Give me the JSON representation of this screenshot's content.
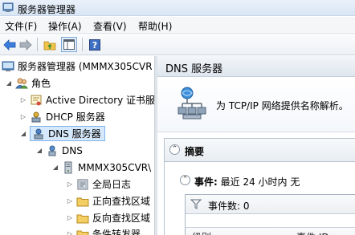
{
  "window": {
    "title": "服务器管理器"
  },
  "menu": [
    "文件(F)",
    "操作(A)",
    "查看(V)",
    "帮助(H)"
  ],
  "toolbar": {
    "icons": [
      "back-arrow-icon",
      "forward-arrow-icon",
      "up-folder-icon",
      "show-hide-tree-icon",
      "help-icon"
    ]
  },
  "tree": {
    "root": "服务器管理器 (MMMX305CVR",
    "roles": "角色",
    "adcs": "Active Directory 证书服",
    "dhcp": "DHCP 服务器",
    "dns_server": "DNS 服务器",
    "dns": "DNS",
    "host": "MMMX305CVR\\",
    "global_log": "全局日志",
    "forward_zone": "正向查找区域",
    "reverse_zone": "反向查找区域",
    "conditional_fwd": "条件转发器"
  },
  "right": {
    "header": "DNS 服务器",
    "intro": "为 TCP/IP 网络提供名称解析。",
    "summary": "摘要",
    "events_label": "事件:",
    "events_value": "最近 24 小时内 无",
    "event_count": "事件数: 0",
    "col_level": "级别",
    "col_event_id": "事件 ID"
  }
}
